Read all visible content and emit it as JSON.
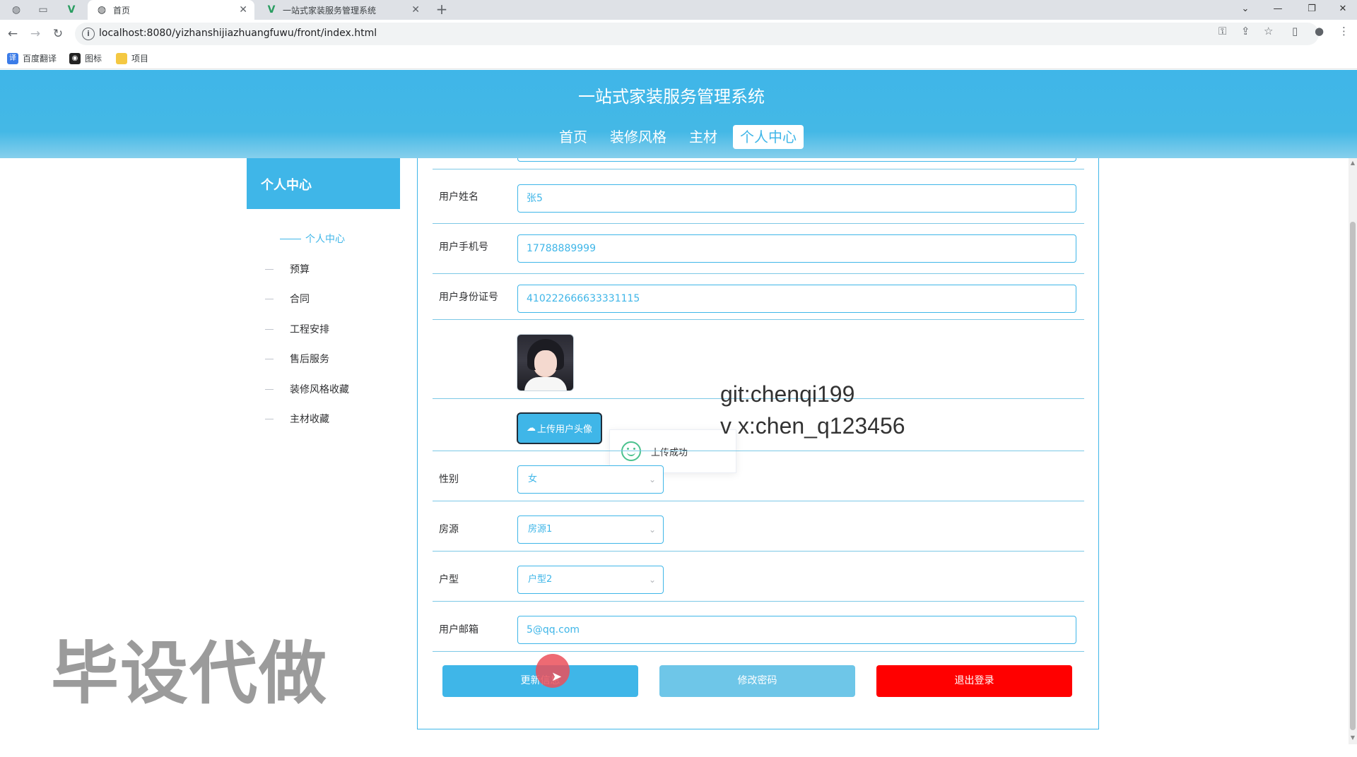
{
  "browser": {
    "tabs": [
      {
        "title": "首页",
        "active": true
      },
      {
        "title": "一站式家装服务管理系统",
        "active": false
      }
    ],
    "url": "localhost:8080/yizhanshijiazhuangfuwu/front/index.html",
    "bookmarks": [
      "百度翻译",
      "图标",
      "项目"
    ]
  },
  "site": {
    "title": "一站式家装服务管理系统",
    "menu": [
      "首页",
      "装修风格",
      "主材",
      "个人中心"
    ],
    "active_menu": "个人中心"
  },
  "sidebar": {
    "heading": "个人中心",
    "items": [
      {
        "label": "个人中心",
        "active": true
      },
      {
        "label": "预算"
      },
      {
        "label": "合同"
      },
      {
        "label": "工程安排"
      },
      {
        "label": "售后服务"
      },
      {
        "label": "装修风格收藏"
      },
      {
        "label": "主材收藏"
      }
    ]
  },
  "form": {
    "name_label": "用户姓名",
    "name_value": "张5",
    "phone_label": "用户手机号",
    "phone_value": "17788889999",
    "idcard_label": "用户身份证号",
    "idcard_value": "410222666633331115",
    "upload_label": "上传用户头像",
    "upload_toast": "上传成功",
    "gender_label": "性别",
    "gender_value": "女",
    "house_label": "房源",
    "house_value": "房源1",
    "layout_label": "户型",
    "layout_value": "户型2",
    "email_label": "用户邮箱",
    "email_value": "5@qq.com"
  },
  "buttons": {
    "update": "更新信息",
    "change_password": "修改密码",
    "logout": "退出登录"
  },
  "colors": {
    "primary": "#3fb6e8",
    "secondary_button": "#6ec6e8",
    "danger": "#ff0000"
  },
  "watermarks": {
    "git": "git:chenqi199",
    "vx": "v x:chen_q123456",
    "big": "毕设代做"
  }
}
